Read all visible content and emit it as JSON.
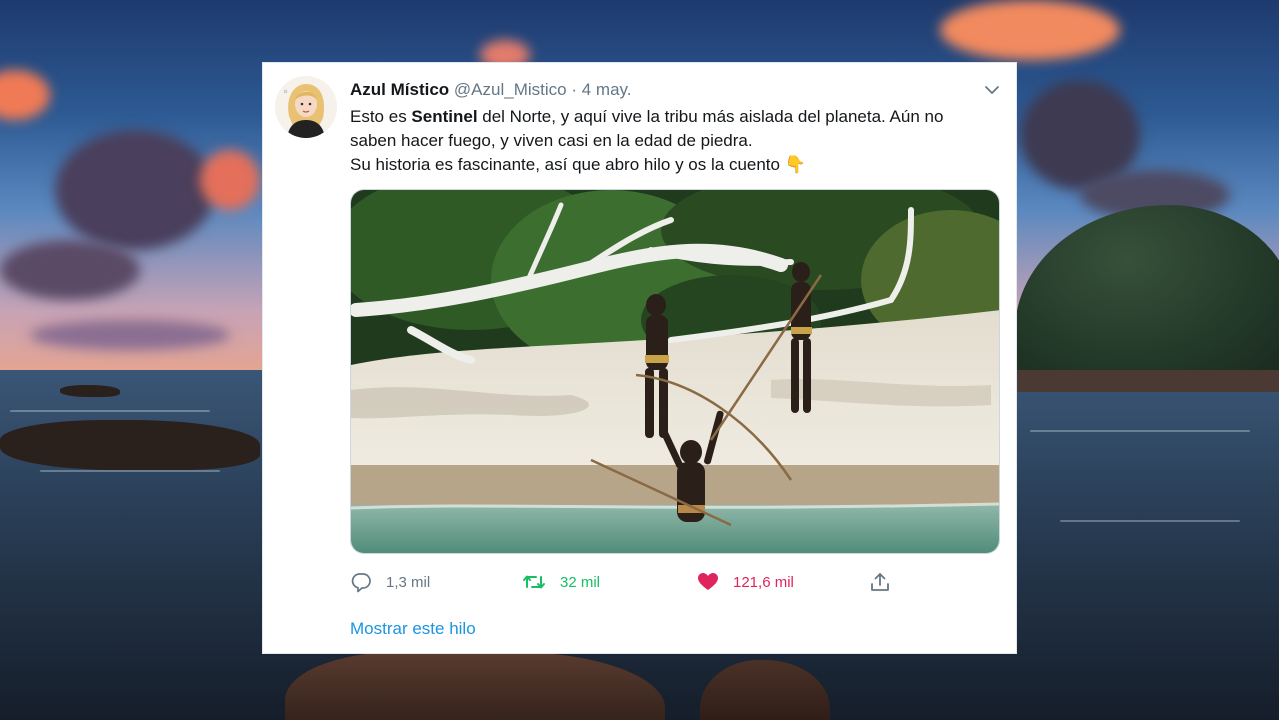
{
  "tweet": {
    "display_name": "Azul Místico",
    "handle": "@Azul_Mistico",
    "separator": "·",
    "date": "4 may.",
    "text_part1": "Esto es ",
    "text_bold": "Sentinel",
    "text_part2": " del Norte, y aquí vive la tribu más aislada del planeta. Aún no saben hacer fuego, y viven casi en la edad de piedra.",
    "text_line3": "Su historia es fascinante, así que abro hilo y os la cuento ",
    "emoji": "👇",
    "reply_count": "1,3 mil",
    "retweet_count": "32 mil",
    "like_count": "121,6 mil",
    "thread_link": "Mostrar este hilo"
  },
  "icons": {
    "reply": "reply-icon",
    "retweet": "retweet-icon",
    "like": "heart-icon",
    "share": "share-icon",
    "menu": "chevron-down-icon"
  },
  "colors": {
    "text": "#14171a",
    "muted": "#657786",
    "retweet": "#17bf63",
    "like": "#e0245e",
    "link": "#1b95e0"
  }
}
